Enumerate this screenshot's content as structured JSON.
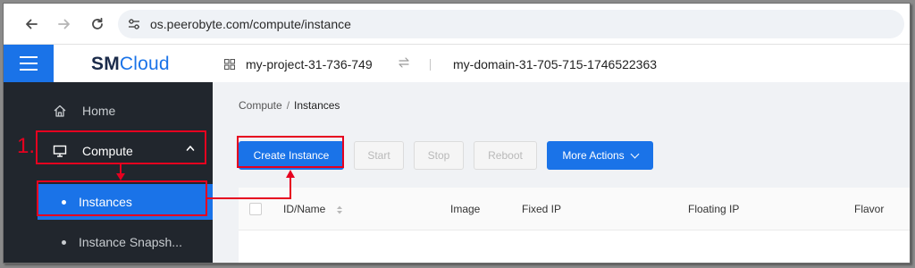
{
  "browser": {
    "url": "os.peerobyte.com/compute/instance",
    "icons": [
      "back-arrow-icon",
      "forward-arrow-icon",
      "reload-icon",
      "site-settings-icon"
    ]
  },
  "header": {
    "logo_bold": "SM",
    "logo_light": "Cloud",
    "project": "my-project-31-736-749",
    "domain": "my-domain-31-705-715-1746522363",
    "brand_color": "#1a73e8"
  },
  "sidebar": {
    "items": [
      {
        "label": "Home",
        "icon": "home-icon"
      },
      {
        "label": "Compute",
        "icon": "monitor-icon",
        "expanded": true
      }
    ],
    "subitems": [
      {
        "label": "Instances",
        "active": true
      },
      {
        "label": "Instance Snapsh..."
      }
    ]
  },
  "main": {
    "breadcrumb": {
      "parent": "Compute",
      "separator": "/",
      "current": "Instances"
    },
    "buttons": {
      "create": "Create Instance",
      "start": "Start",
      "stop": "Stop",
      "reboot": "Reboot",
      "more": "More Actions"
    },
    "table": {
      "columns": [
        "ID/Name",
        "Image",
        "Fixed IP",
        "Floating IP",
        "Flavor"
      ]
    }
  },
  "annotation": {
    "step": "1.",
    "color": "#e6001f"
  }
}
